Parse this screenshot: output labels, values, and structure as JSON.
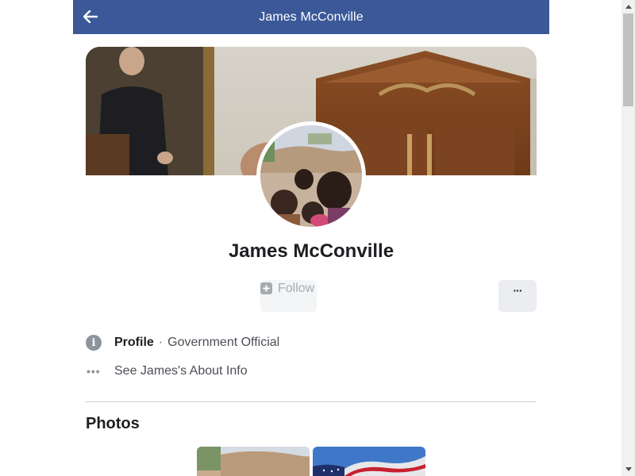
{
  "header": {
    "title": "James McConville",
    "back_icon": "back-arrow-icon"
  },
  "profile": {
    "name": "James McConville",
    "follow_label": "Follow",
    "more_label": "···"
  },
  "info": {
    "profile_label": "Profile",
    "separator": "·",
    "category": "Government Official",
    "about_link": "See James's About Info"
  },
  "photos": {
    "title": "Photos"
  },
  "colors": {
    "header_bg": "#3b5998",
    "button_bg": "#ebedf0",
    "icon_gray": "#8d949e",
    "text_primary": "#1c1e21",
    "text_secondary": "#4b4f56"
  }
}
